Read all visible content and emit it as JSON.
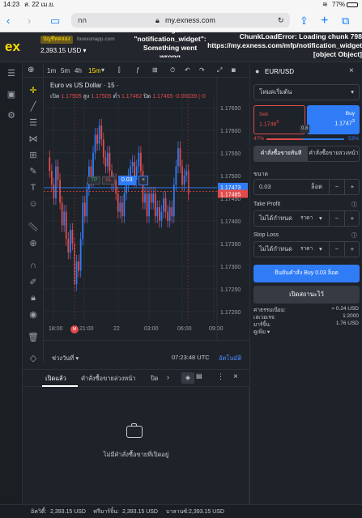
{
  "status": {
    "time": "14:23",
    "date": "ส. 22 เม.ย.",
    "battery": "77%"
  },
  "browser": {
    "tab_label": "กก",
    "domain": "my.exness.com"
  },
  "header": {
    "account_type": "บัญชีทดลอง",
    "site": "forexonapp.com",
    "balance": "2,393.15 USD",
    "error_left": [
      "Widget",
      "\"notification_widget\":",
      "Something went",
      "wrong"
    ],
    "error_right": [
      "ChunkLoadError: Loading chunk 798",
      "https://my.exness.com/mfp/notification_widget",
      "[object Object]"
    ]
  },
  "chart": {
    "timeframes": [
      "1m",
      "5m",
      "4h",
      "15m"
    ],
    "active_tf": "15m",
    "title": "Euro vs US Dollar · 15 ·",
    "ohlc": {
      "o_label": "เปิด",
      "o": "1.17505",
      "h_label": "สูง",
      "h": "1.17505",
      "l_label": "ต่ำ",
      "l": "1.17462",
      "c_label": "ปิด",
      "c": "1.17465",
      "chg": "-0.00039 (-0"
    },
    "price_ticks": [
      "1.17650",
      "1.17600",
      "1.17550",
      "1.17500",
      "1.17450",
      "1.17400",
      "1.17350",
      "1.17300",
      "1.17250",
      "1.17200"
    ],
    "time_ticks": [
      "18:00",
      "21:00",
      "22",
      "03:00",
      "06:00",
      "09:00"
    ],
    "tag_ask": "1.17473",
    "tag_bid": "1.17465",
    "tp": "TP",
    "sl": "SL",
    "qty": "0.03",
    "close_x": "×",
    "range_label": "ช่วงวันที่",
    "clock": "07:23:48 UTC",
    "auto": "อัตโนมัติ",
    "marker": "M"
  },
  "chart_data": {
    "type": "candlestick",
    "title": "Euro vs US Dollar · 15",
    "ylim": [
      1.1718,
      1.1768
    ],
    "x_labels": [
      "18:00",
      "21:00",
      "22",
      "03:00",
      "06:00",
      "09:00"
    ],
    "closes": [
      1.1751,
      1.1748,
      1.1745,
      1.1752,
      1.1749,
      1.1744,
      1.1739,
      1.1742,
      1.1736,
      1.1733,
      1.1738,
      1.1735,
      1.1726,
      1.1731,
      1.1729,
      1.1736,
      1.1744,
      1.1741,
      1.1747,
      1.1752,
      1.1749,
      1.1755,
      1.1759,
      1.1757,
      1.1761,
      1.1758,
      1.1754,
      1.1752,
      1.1755,
      1.1751,
      1.1748,
      1.1749,
      1.1746,
      1.1742,
      1.1744,
      1.1741,
      1.1746,
      1.1748,
      1.175,
      1.1752,
      1.1753,
      1.1749,
      1.1752,
      1.1755,
      1.1751,
      1.1744,
      1.1746,
      1.1741,
      1.1746,
      1.1744,
      1.1746,
      1.1741,
      1.1743,
      1.174,
      1.1742,
      1.1745,
      1.1742,
      1.174,
      1.1743,
      1.1741,
      1.1748,
      1.1752,
      1.1756,
      1.1752,
      1.1748,
      1.175,
      1.1751,
      1.1746
    ]
  },
  "panel": {
    "symbol": "EUR/USD",
    "mode": "โหมดเริ่มต้น",
    "sell_label": "Sell",
    "sell_big": "1.1746",
    "sell_small": "5",
    "buy_label": "Buy",
    "buy_big": "1.1747",
    "buy_small": "3",
    "spread": "0.8",
    "pct_sell": "47%",
    "pct_buy": "53%",
    "tab_market": "คำสั่งซื้อขายทันที",
    "tab_pending": "คำสั่งซื้อขายล่วงหน้า",
    "size_label": "ขนาด",
    "size_value": "0.03",
    "size_unit": "ล็อต",
    "minus": "−",
    "plus": "+",
    "tp_label": "Take Profit",
    "sl_label": "Stop Loss",
    "not_set": "ไม่ได้กำหนด",
    "price_unit": "ราคา",
    "confirm": "ยืนยันคำสั่ง Buy 0.03 ล็อต",
    "cancel": "เปิดสถานะไว้",
    "fee_label": "ค่าธรรมเนียม:",
    "fee_value": "≈ 0.24 USD",
    "lev_label": "เลเวอเรจ:",
    "lev_value": "1:2000",
    "margin_label": "มาร์จิ้น:",
    "margin_value": "1.76 USD",
    "more": "ดูเพิ่ม"
  },
  "tabs": {
    "open": "เปิดแล้ว",
    "pending": "คำสั่งซื้อขายล่วงหน้า",
    "closed": "ปิด"
  },
  "empty": "ไม่มีคำสั่งซื้อขายที่เปิดอยู่",
  "footer": {
    "equity_label": "อิควิตี้:",
    "equity": "2,393.15 USD",
    "free_label": "ฟรีมาร์จิ้น:",
    "free": "2,393.15 USD",
    "bal_label": "บาลานซ์:",
    "bal": "2,393.15 USD"
  },
  "colors": {
    "buy": "#2f7cf6",
    "sell": "#e34b4b",
    "bg": "#1e2229",
    "accent": "#ffde02"
  }
}
